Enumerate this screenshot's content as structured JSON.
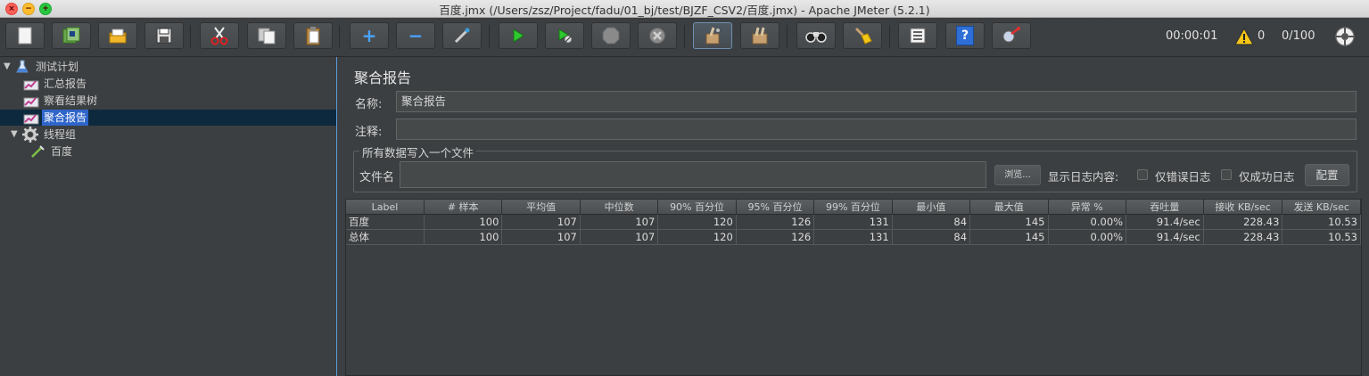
{
  "window": {
    "title": "百度.jmx (/Users/zsz/Project/fadu/01_bj/test/BJZF_CSV2/百度.jmx) - Apache JMeter (5.2.1)"
  },
  "toolbar": {
    "buttons": [
      {
        "icon": "new-icon"
      },
      {
        "icon": "templates-icon"
      },
      {
        "icon": "open-icon"
      },
      {
        "icon": "save-icon"
      },
      {
        "icon": "cut-icon"
      },
      {
        "icon": "copy-icon"
      },
      {
        "icon": "paste-icon"
      },
      {
        "icon": "expand-icon",
        "glyph": "+"
      },
      {
        "icon": "collapse-icon",
        "glyph": "−"
      },
      {
        "icon": "toggle-icon"
      },
      {
        "icon": "start-icon"
      },
      {
        "icon": "start-no-pauses-icon"
      },
      {
        "icon": "stop-icon"
      },
      {
        "icon": "shutdown-icon"
      },
      {
        "icon": "clear-icon"
      },
      {
        "icon": "clear-all-icon"
      },
      {
        "icon": "search-icon"
      },
      {
        "icon": "reset-search-icon"
      },
      {
        "icon": "function-helper-icon"
      },
      {
        "icon": "help-icon",
        "glyph": "?"
      },
      {
        "icon": "remote-icon"
      }
    ]
  },
  "status": {
    "elapsed": "00:00:01",
    "warnings": "0",
    "threads": "0/100"
  },
  "tree": {
    "items": [
      {
        "label": "测试计划",
        "icon": "test-plan-icon"
      },
      {
        "label": "汇总报告",
        "icon": "listener-icon"
      },
      {
        "label": "察看结果树",
        "icon": "listener-icon"
      },
      {
        "label": "聚合报告",
        "icon": "listener-icon"
      },
      {
        "label": "线程组",
        "icon": "thread-group-icon"
      },
      {
        "label": "百度",
        "icon": "sampler-icon"
      }
    ]
  },
  "panel": {
    "title": "聚合报告",
    "name_label": "名称:",
    "name_value": "聚合报告",
    "comment_label": "注释:",
    "comment_value": "",
    "file_group_title": "所有数据写入一个文件",
    "filename_label": "文件名",
    "filename_value": "",
    "browse_label": "浏览...",
    "log_content_label": "显示日志内容:",
    "errors_only_label": "仅错误日志",
    "success_only_label": "仅成功日志",
    "configure_label": "配置"
  },
  "table": {
    "headers": [
      "Label",
      "# 样本",
      "平均值",
      "中位数",
      "90% 百分位",
      "95% 百分位",
      "99% 百分位",
      "最小值",
      "最大值",
      "异常 %",
      "吞吐量",
      "接收 KB/sec",
      "发送 KB/sec"
    ],
    "rows": [
      [
        "百度",
        "100",
        "107",
        "107",
        "120",
        "126",
        "131",
        "84",
        "145",
        "0.00%",
        "91.4/sec",
        "228.43",
        "10.53"
      ],
      [
        "总体",
        "100",
        "107",
        "107",
        "120",
        "126",
        "131",
        "84",
        "145",
        "0.00%",
        "91.4/sec",
        "228.43",
        "10.53"
      ]
    ]
  }
}
